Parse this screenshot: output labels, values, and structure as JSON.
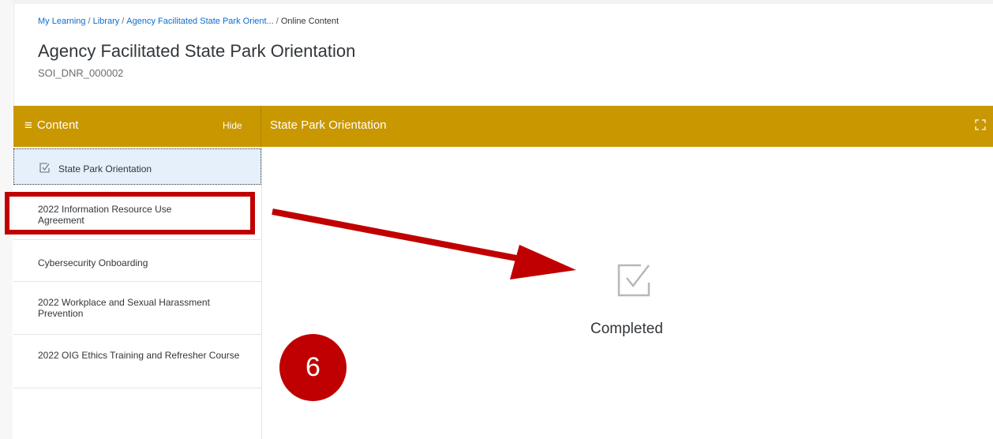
{
  "breadcrumb": {
    "items": [
      "My Learning",
      "Library",
      "Agency Facilitated State Park Orient..."
    ],
    "current": "Online Content",
    "separator": "/"
  },
  "course": {
    "title": "Agency Facilitated State Park Orientation",
    "code": "SOI_DNR_000002"
  },
  "content_panel": {
    "toggle_label": "Content",
    "hide_label": "Hide",
    "items": [
      {
        "label": "State Park Orientation",
        "completed": true,
        "selected": true
      },
      {
        "label": "2022 Information Resource Use Agreement",
        "completed": false,
        "selected": false
      },
      {
        "label": "Cybersecurity Onboarding",
        "completed": false,
        "selected": false
      },
      {
        "label": "2022 Workplace and Sexual Harassment Prevention",
        "completed": false,
        "selected": false
      },
      {
        "label": "2022 OIG Ethics Training and Refresher Course",
        "completed": false,
        "selected": false
      }
    ]
  },
  "viewer": {
    "title": "State Park Orientation",
    "status": "Completed",
    "icons": [
      "menu-icon",
      "expand-icon",
      "checkbox-checked-icon"
    ]
  },
  "annotation": {
    "step_number": "6",
    "color": "#c00000"
  },
  "colors": {
    "accent_bar": "#c99700",
    "link": "#0a6ed1",
    "selected_bg": "#e5f0fa"
  }
}
